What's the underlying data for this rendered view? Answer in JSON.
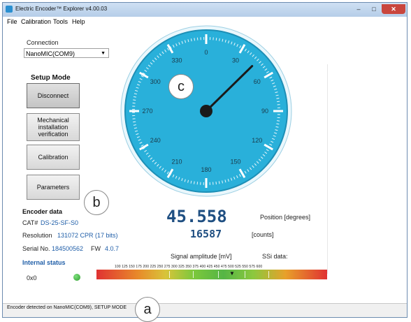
{
  "window": {
    "title": "Electric Encoder™ Explorer v4.00.03",
    "controls": {
      "minimize": "–",
      "maximize": "□",
      "close": "✕"
    }
  },
  "menu": [
    "File",
    "Calibration",
    "Tools",
    "Help"
  ],
  "connection": {
    "label": "Connection",
    "selected": "NanoMIC(COM9)"
  },
  "setup_mode": {
    "title": "Setup Mode",
    "buttons": [
      "Disconnect",
      "Mechanical installation verification",
      "Calibration",
      "Parameters"
    ]
  },
  "encoder_data": {
    "title": "Encoder data",
    "cat_label": "CAT#",
    "cat_value": "DS-25-SF-S0",
    "resolution_label": "Resolution",
    "resolution_value": "131072 CPR (17 bits)",
    "serial_label": "Serial No.",
    "serial_value": "184500562",
    "fw_label": "FW",
    "fw_value": "4.0.7"
  },
  "internal_status": {
    "title": "Internal status",
    "value": "0x0",
    "led_color": "#2e9e2e"
  },
  "gauge": {
    "labels": [
      "0",
      "30",
      "60",
      "90",
      "120",
      "150",
      "180",
      "210",
      "240",
      "270",
      "300",
      "330"
    ],
    "needle_angle_deg": 45.558,
    "face_color": "#29b0da"
  },
  "position": {
    "value": "45.558",
    "unit": "Position [degrees]",
    "counts": "16587",
    "counts_unit": "[counts]"
  },
  "signal": {
    "label": "Signal amplitude [mV]",
    "ssi_label": "SSi data:",
    "scale": "100 125 150 175 200 225 250 275 300 325 350 375 400 425 450 475 500 525 550 575 600",
    "marker": "▼"
  },
  "status_bar": "Encoder detected on NanoMIC(COM9), SETUP MODE",
  "callouts": {
    "a": "a",
    "b": "b",
    "c": "c"
  }
}
